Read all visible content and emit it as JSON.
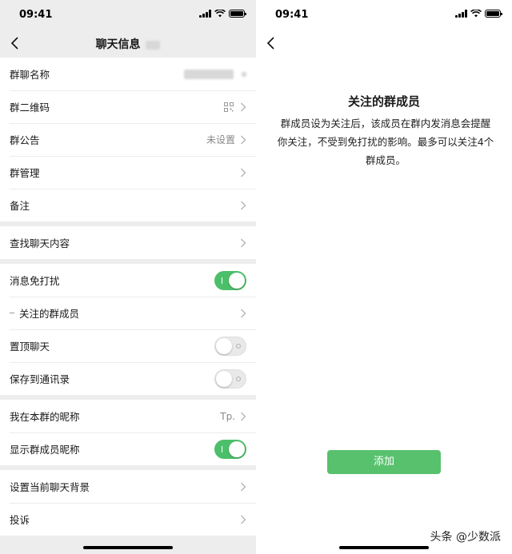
{
  "left": {
    "status_time": "09:41",
    "title": "聊天信息",
    "groups": [
      {
        "rows": [
          {
            "label": "群聊名称",
            "value": "",
            "control": "blurred"
          },
          {
            "label": "群二维码",
            "value": "",
            "control": "qr"
          },
          {
            "label": "群公告",
            "value": "未设置",
            "control": "chevron"
          },
          {
            "label": "群管理",
            "value": "",
            "control": "chevron"
          },
          {
            "label": "备注",
            "value": "",
            "control": "chevron"
          }
        ]
      },
      {
        "rows": [
          {
            "label": "查找聊天内容",
            "value": "",
            "control": "chevron"
          }
        ]
      },
      {
        "rows": [
          {
            "label": "消息免打扰",
            "value": "",
            "control": "toggle",
            "on": true
          },
          {
            "label": "关注的群成员",
            "value": "",
            "control": "chevron",
            "dash": true
          },
          {
            "label": "置顶聊天",
            "value": "",
            "control": "toggle",
            "on": false
          },
          {
            "label": "保存到通讯录",
            "value": "",
            "control": "toggle",
            "on": false
          }
        ]
      },
      {
        "rows": [
          {
            "label": "我在本群的昵称",
            "value": "Tp.",
            "control": "chevron"
          },
          {
            "label": "显示群成员昵称",
            "value": "",
            "control": "toggle",
            "on": true
          }
        ]
      },
      {
        "rows": [
          {
            "label": "设置当前聊天背景",
            "value": "",
            "control": "chevron"
          },
          {
            "label": "投诉",
            "value": "",
            "control": "chevron"
          }
        ]
      }
    ]
  },
  "right": {
    "status_time": "09:41",
    "title": "关注的群成员",
    "description": "群成员设为关注后，该成员在群内发消息会提醒你关注，不受到免打扰的影响。最多可以关注4个群成员。",
    "add_button": "添加",
    "watermark": "头条 @少数派"
  },
  "colors": {
    "accent_green": "#4cbf6b",
    "button_green": "#58c16d",
    "background_gray": "#ededed"
  }
}
